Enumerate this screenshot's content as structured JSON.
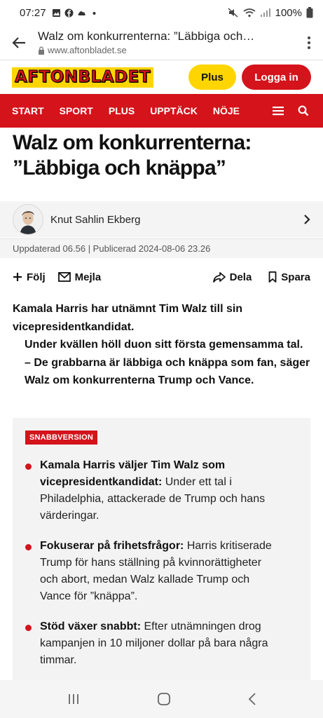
{
  "status_bar": {
    "time": "07:27",
    "battery": "100%"
  },
  "browser": {
    "page_title": "Walz om konkurrenterna: ”Läbbiga och…",
    "url": "www.aftonbladet.se"
  },
  "site_header": {
    "logo_text": "AFTONBLADET",
    "plus_label": "Plus",
    "login_label": "Logga in"
  },
  "nav": {
    "items": [
      "START",
      "SPORT",
      "PLUS",
      "UPPTÄCK",
      "NÖJE"
    ]
  },
  "article": {
    "headline_line1": "Walz om konkurrenterna:",
    "headline_line2": "”Läbbiga och knäppa”",
    "author": "Knut Sahlin Ekberg",
    "meta": "Uppdaterad 06.56 | Publicerad 2024-08-06 23.26",
    "actions": {
      "follow": "Följ",
      "email": "Mejla",
      "share": "Dela",
      "save": "Spara"
    },
    "lead": {
      "p1": "Kamala Harris har utnämnt Tim Walz till sin vicepresidentkandidat.",
      "p2": "Under kvällen höll duon sitt första gemensamma tal.",
      "p3": "– De grabbarna är läbbiga och knäppa som fan, säger Walz om konkurrenterna Trump och Vance."
    },
    "snabbversion": {
      "badge": "SNABBVERSION",
      "bullets": [
        {
          "bold": "Kamala Harris väljer Tim Walz som vicepresidentkandidat:",
          "text": " Under ett tal i Philadelphia, attackerade de Trump och hans värderingar."
        },
        {
          "bold": "Fokuserar på frihetsfrågor:",
          "text": " Harris kritiserade Trump för hans ställning på kvinnorättigheter och abort, medan Walz kallade Trump och Vance för ”knäppa”."
        },
        {
          "bold": "Stöd växer snabbt:",
          "text": " Efter utnämningen drog kampanjen in 10 miljoner dollar på bara några timmar."
        }
      ]
    }
  },
  "colors": {
    "brand_red": "#d4131b",
    "brand_yellow": "#ffd500"
  }
}
